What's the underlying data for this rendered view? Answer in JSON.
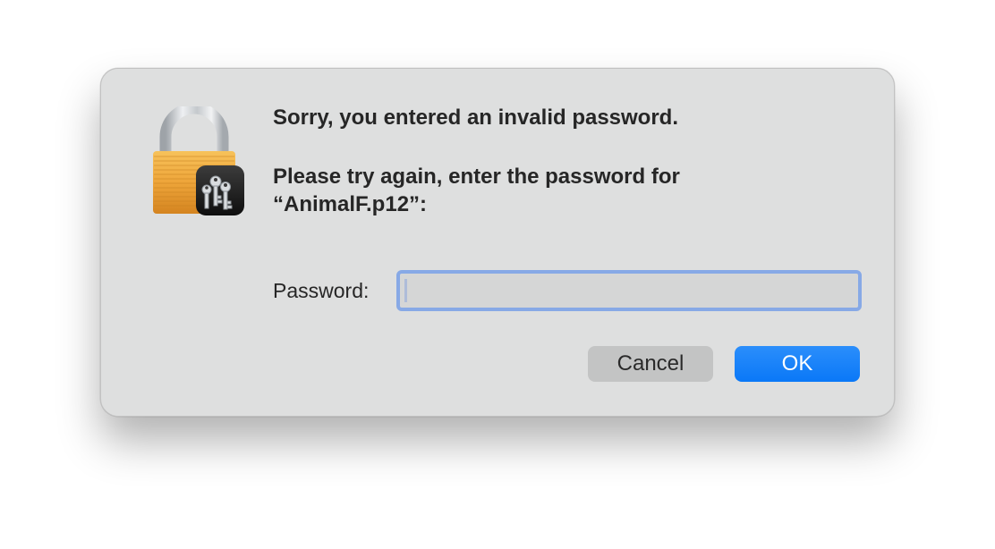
{
  "dialog": {
    "icon": "keychain-lock-icon",
    "headline": "Sorry, you entered an invalid password.",
    "prompt": "Please try again, enter the password for “AnimalF.p12”:",
    "password_label": "Password:",
    "password_value": "",
    "cancel_label": "Cancel",
    "ok_label": "OK"
  },
  "colors": {
    "dialog_background": "#dedfdf",
    "field_focus_ring": "#87a9e6",
    "ok_button": "#0a78f7",
    "cancel_button": "#c3c4c4",
    "text": "#262626",
    "lock_body": "#f0a22e",
    "lock_shackle": "#c9ced3"
  }
}
